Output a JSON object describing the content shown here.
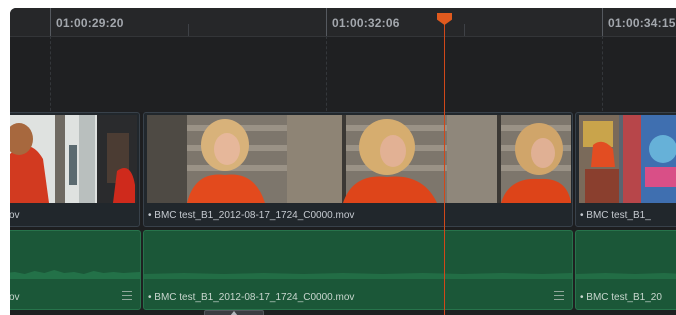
{
  "ruler": {
    "timecodes": [
      "01:00:29:20",
      "01:00:32:06",
      "01:00:34:15"
    ]
  },
  "tracks": {
    "video": {
      "clips": [
        {
          "label": "ov"
        },
        {
          "label": "• BMC test_B1_2012-08-17_1724_C0000.mov"
        },
        {
          "label": "• BMC test_B1_"
        }
      ]
    },
    "audio": {
      "clips": [
        {
          "label": "ov"
        },
        {
          "label": "• BMC test_B1_2012-08-17_1724_C0000.mov"
        },
        {
          "label": "• BMC test_B1_20"
        }
      ]
    }
  },
  "colors": {
    "playhead": "#e05a1e",
    "video_clip": "#21272c",
    "audio_clip": "#1b5738",
    "background": "#1d1e20"
  },
  "icons": {
    "playhead": "playhead-marker-icon",
    "clip_menu": "menu-lines-icon",
    "scroll": "scroll-handle-icon"
  }
}
